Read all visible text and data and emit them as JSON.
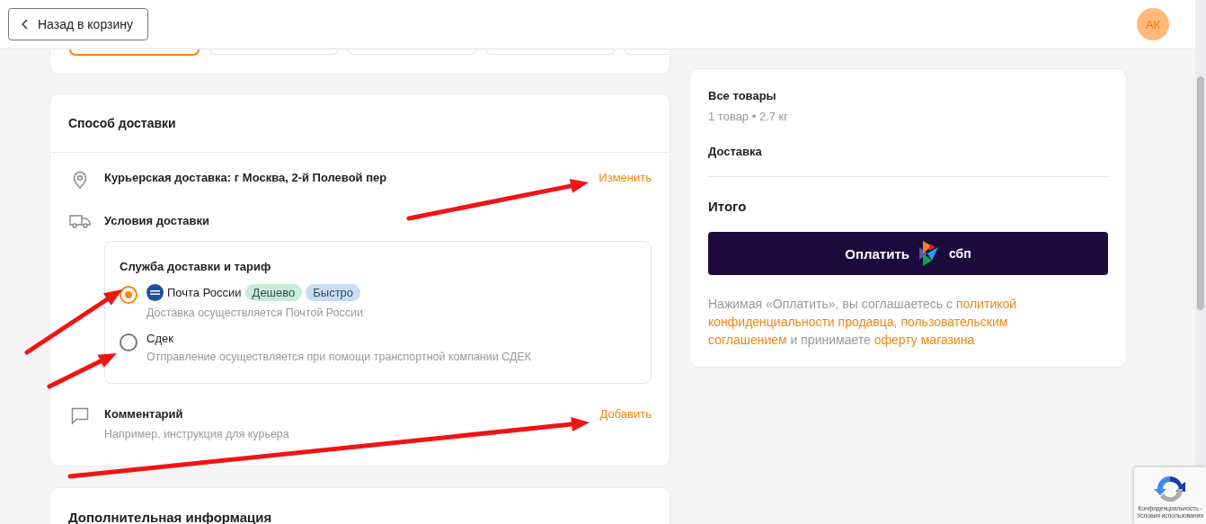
{
  "header": {
    "back_button": "Назад в корзину",
    "avatar": "АК"
  },
  "top_card": {
    "tiles": [
      {
        "selected": true
      },
      {
        "selected": false
      },
      {
        "selected": false
      },
      {
        "selected": false
      },
      {
        "selected": false
      }
    ]
  },
  "delivery": {
    "title": "Способ доставки",
    "address": {
      "text": "Курьерская доставка: г Москва, 2-й Полевой пер",
      "action": "Изменить"
    },
    "conditions": {
      "title": "Условия доставки",
      "service_title": "Служба доставки и тариф",
      "options": [
        {
          "name": "Почта России",
          "selected": true,
          "logo": true,
          "badges": [
            {
              "label": "Дешево",
              "color": "#c8ecd8"
            },
            {
              "label": "Быстро",
              "color": "#c9dcf6"
            }
          ],
          "description": "Доставка осуществляется Почтой России"
        },
        {
          "name": "Сдек",
          "selected": false,
          "logo": false,
          "description": "Отправление осуществляется при помощи транспортной компании СДЕК"
        }
      ]
    },
    "comment": {
      "title": "Комментарий",
      "hint": "Например, инструкция для курьера",
      "action": "Добавить"
    }
  },
  "additional": {
    "title": "Дополнительная информация"
  },
  "summary": {
    "all_items": "Все товары",
    "items_info": "1 товар • 2.7 кг",
    "delivery": "Доставка",
    "total": "Итого",
    "pay_button": "Оплатить",
    "sbp_label": "сбп",
    "consent": [
      {
        "text": "Нажимая «Оплатить», вы соглашаетесь с ",
        "link": false
      },
      {
        "text": "политикой конфиденциальности продавца",
        "link": true
      },
      {
        "text": ", ",
        "link": false
      },
      {
        "text": "пользовательским соглашением",
        "link": true
      },
      {
        "text": " и принимаете ",
        "link": false
      },
      {
        "text": "оферту магазина",
        "link": true
      }
    ]
  },
  "recaptcha": {
    "lines": [
      "Конфиденциальность -",
      "Условия использования"
    ]
  },
  "annotation_arrows": [
    {
      "kind": "arrow"
    },
    {
      "kind": "arrow"
    },
    {
      "kind": "arrow"
    },
    {
      "kind": "arrow"
    }
  ]
}
